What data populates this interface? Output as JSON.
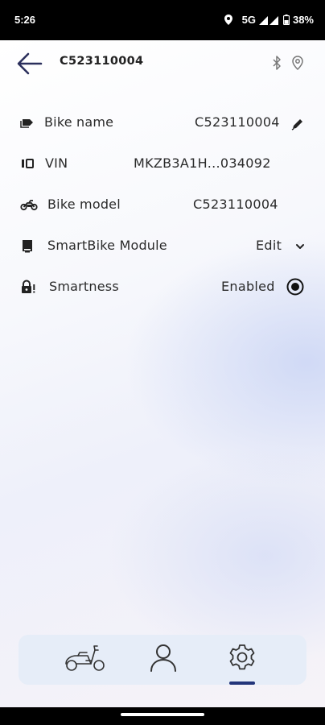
{
  "status_bar": {
    "time": "5:26",
    "network": "5G",
    "battery": "38%"
  },
  "header": {
    "title": "C523110004",
    "back_icon": "arrow-left-icon",
    "bluetooth_icon": "bluetooth-icon",
    "location_icon": "location-pin-icon"
  },
  "rows": [
    {
      "icon": "tag-icon",
      "label": "Bike name",
      "value": "C523110004",
      "action_icon": "pencil-icon"
    },
    {
      "icon": "id-card-icon",
      "label": "VIN",
      "value": "MKZB3A1H...034092"
    },
    {
      "icon": "motorbike-icon",
      "label": "Bike model",
      "value": "C523110004"
    },
    {
      "icon": "module-icon",
      "label": "SmartBike Module",
      "value": "Edit",
      "action_icon": "chevron-down-icon"
    },
    {
      "icon": "lock-alert-icon",
      "label": "Smartness",
      "value": "Enabled",
      "action_icon": "radio-selected-icon"
    }
  ],
  "bottom_nav": {
    "items": [
      {
        "name": "scooter-icon"
      },
      {
        "name": "person-icon"
      },
      {
        "name": "gear-icon",
        "active": true
      }
    ],
    "accent": "#23357a"
  }
}
